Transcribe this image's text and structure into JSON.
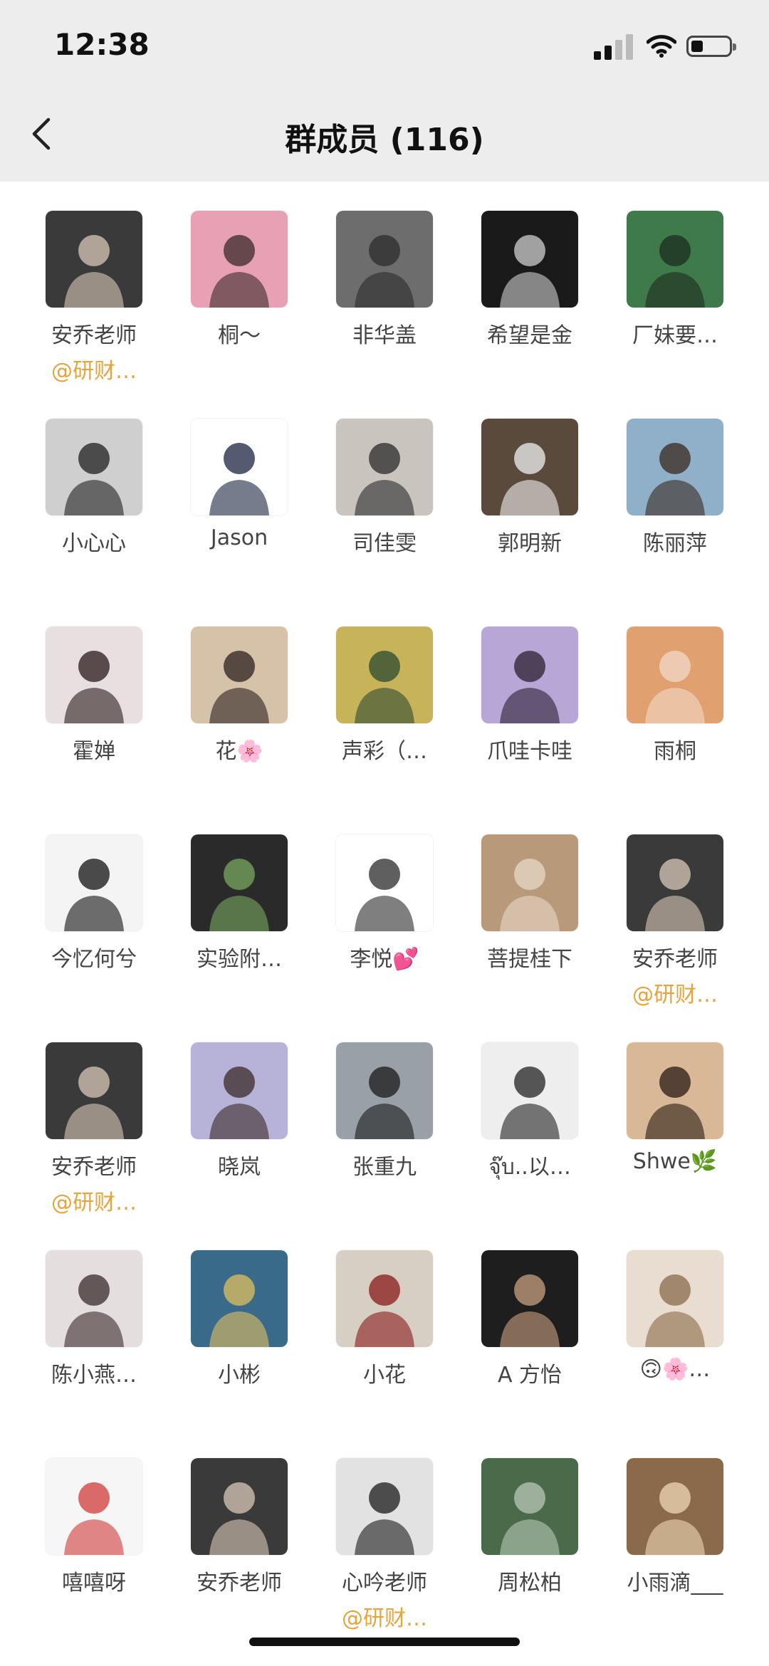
{
  "status_bar": {
    "time": "12:38"
  },
  "nav": {
    "title": "群成员 (116)"
  },
  "members": [
    {
      "name": "安乔老师",
      "tag": "@研财…",
      "avatar": "portrait-man-suit",
      "bg": "#3a3a3a",
      "fg": "#d8c8b8"
    },
    {
      "name": "桐～",
      "avatar": "girl-pink-light",
      "bg": "#e8a0b4",
      "fg": "#3a2a2a"
    },
    {
      "name": "非华盖",
      "avatar": "tiger-gray",
      "bg": "#6d6d6d",
      "fg": "#2c2c2c"
    },
    {
      "name": "希望是金",
      "avatar": "fist-bw",
      "bg": "#1a1a1a",
      "fg": "#cfcfcf"
    },
    {
      "name": "厂妹要…",
      "avatar": "aquarium-green",
      "bg": "#3f7a4a",
      "fg": "#1c2c20"
    },
    {
      "name": "小心心",
      "avatar": "woman-back-gray",
      "bg": "#cfcfcf",
      "fg": "#1f1f1f"
    },
    {
      "name": "Jason",
      "avatar": "man-suit-white",
      "bg": "#ffffff",
      "fg": "#1b2440"
    },
    {
      "name": "司佳雯",
      "avatar": "woman-glasses",
      "bg": "#c9c4bd",
      "fg": "#2b2b2b"
    },
    {
      "name": "郭明新",
      "avatar": "man-desk",
      "bg": "#5a4a3c",
      "fg": "#f0f0f0"
    },
    {
      "name": "陈丽萍",
      "avatar": "mother-child-sea",
      "bg": "#8fb0c8",
      "fg": "#3a2a22"
    },
    {
      "name": "霍婵",
      "avatar": "girl-long-hair",
      "bg": "#e8e0e0",
      "fg": "#2a1a1a"
    },
    {
      "name": "花🌸",
      "avatar": "woman-indoor",
      "bg": "#d6c2a8",
      "fg": "#2a2020"
    },
    {
      "name": "声彩（…",
      "avatar": "vangogh-painting",
      "bg": "#c7b45a",
      "fg": "#2e4a30"
    },
    {
      "name": "爪哇卡哇",
      "avatar": "ponytail-purple",
      "bg": "#b8a6d6",
      "fg": "#2a2030"
    },
    {
      "name": "雨桐",
      "avatar": "woman-golden",
      "bg": "#e0a070",
      "fg": "#f4d8c8"
    },
    {
      "name": "今忆何兮",
      "avatar": "calligraphy",
      "bg": "#f4f4f4",
      "fg": "#111111"
    },
    {
      "name": "实验附…",
      "avatar": "window-landscape",
      "bg": "#2a2a2a",
      "fg": "#7aa860"
    },
    {
      "name": "李悦💕",
      "avatar": "cartoon-couple",
      "bg": "#ffffff",
      "fg": "#2a2a2a"
    },
    {
      "name": "菩提桂下",
      "avatar": "woman-flowers",
      "bg": "#b89a7a",
      "fg": "#e8d8c8"
    },
    {
      "name": "安乔老师",
      "tag": "@研财…",
      "avatar": "portrait-man-suit",
      "bg": "#3a3a3a",
      "fg": "#d8c8b8"
    },
    {
      "name": "安乔老师",
      "tag": "@研财…",
      "avatar": "portrait-man-suit",
      "bg": "#3a3a3a",
      "fg": "#d8c8b8"
    },
    {
      "name": "晓岚",
      "avatar": "girl-lavender",
      "bg": "#b7b2d8",
      "fg": "#3a2a2a"
    },
    {
      "name": "张重九",
      "avatar": "man-hill-sky",
      "bg": "#9aa0a8",
      "fg": "#1a1a1a"
    },
    {
      "name": "จุ๊บ..以…",
      "avatar": "fist-sketch",
      "bg": "#eeeeee",
      "fg": "#222222"
    },
    {
      "name": "Shwe🌿",
      "avatar": "woman-curly",
      "bg": "#d8b896",
      "fg": "#2a1a14"
    },
    {
      "name": "陈小燕…",
      "avatar": "mother-baby",
      "bg": "#e4dede",
      "fg": "#3a2a2a"
    },
    {
      "name": "小彬",
      "avatar": "colorful-poster",
      "bg": "#3a6a8a",
      "fg": "#e0c060"
    },
    {
      "name": "小花",
      "avatar": "red-flowers",
      "bg": "#d8cfc4",
      "fg": "#8a1a1a"
    },
    {
      "name": "A 方怡",
      "avatar": "woman-dark",
      "bg": "#1e1e1e",
      "fg": "#c8a080"
    },
    {
      "name": "🙃🌸…",
      "avatar": "baby-bed",
      "bg": "#e8ddd0",
      "fg": "#8a6a4a"
    },
    {
      "name": "嘻嘻呀",
      "avatar": "watermelon-drawing",
      "bg": "#f6f6f6",
      "fg": "#d03a3a"
    },
    {
      "name": "安乔老师",
      "avatar": "portrait-man-suit",
      "bg": "#3a3a3a",
      "fg": "#d8c8b8"
    },
    {
      "name": "心吟老师",
      "tag": "@研财…",
      "avatar": "woman-white-coat",
      "bg": "#e2e2e2",
      "fg": "#1a1a1a"
    },
    {
      "name": "周松柏",
      "avatar": "trees-green",
      "bg": "#4a6a4a",
      "fg": "#b8c8b8"
    },
    {
      "name": "小雨滴___",
      "avatar": "woman-vintage",
      "bg": "#8a6a4a",
      "fg": "#f0d8b8"
    }
  ]
}
